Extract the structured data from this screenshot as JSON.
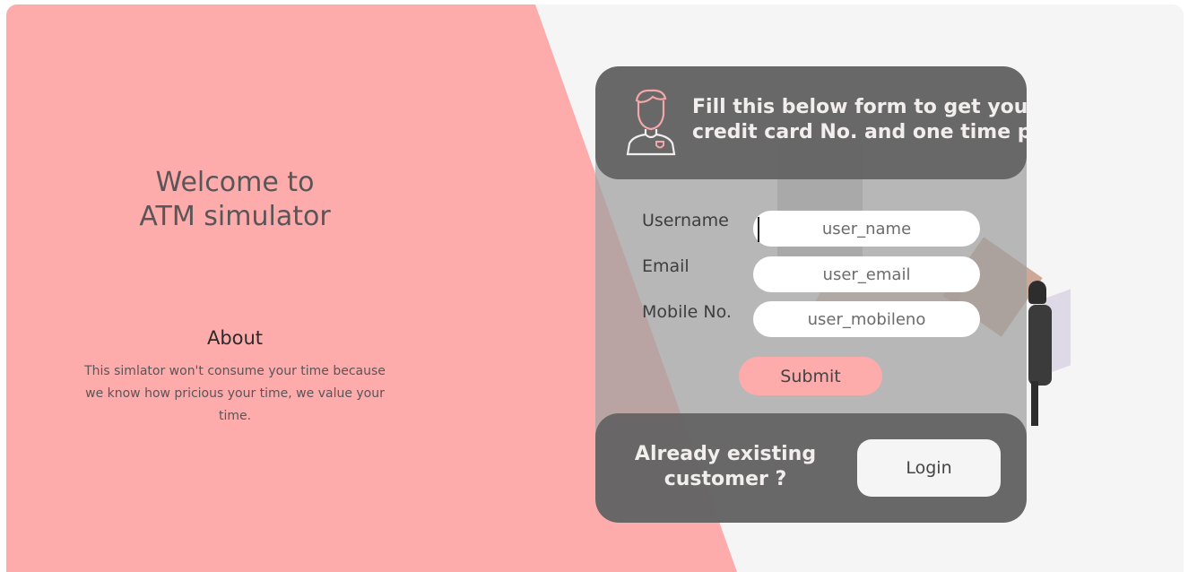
{
  "welcome": {
    "line1": "Welcome to",
    "line2": "ATM simulator"
  },
  "about": {
    "heading": "About",
    "text": "This simlator won't consume your time because we know how pricious your time, we value your time."
  },
  "form": {
    "header_line1": "Fill this below form to get your",
    "header_line2": "credit card No. and one time pin",
    "icon": "user-icon",
    "fields": [
      {
        "label": "Username",
        "placeholder": "user_name"
      },
      {
        "label": "Email",
        "placeholder": "user_email"
      },
      {
        "label": "Mobile No.",
        "placeholder": "user_mobileno"
      }
    ],
    "submit_label": "Submit"
  },
  "footer": {
    "line1": "Already existing",
    "line2": "customer ?",
    "login_label": "Login"
  },
  "colors": {
    "accent_pink": "#feabac",
    "panel_dark": "#5f5f5f",
    "background": "#f5f5f5"
  }
}
